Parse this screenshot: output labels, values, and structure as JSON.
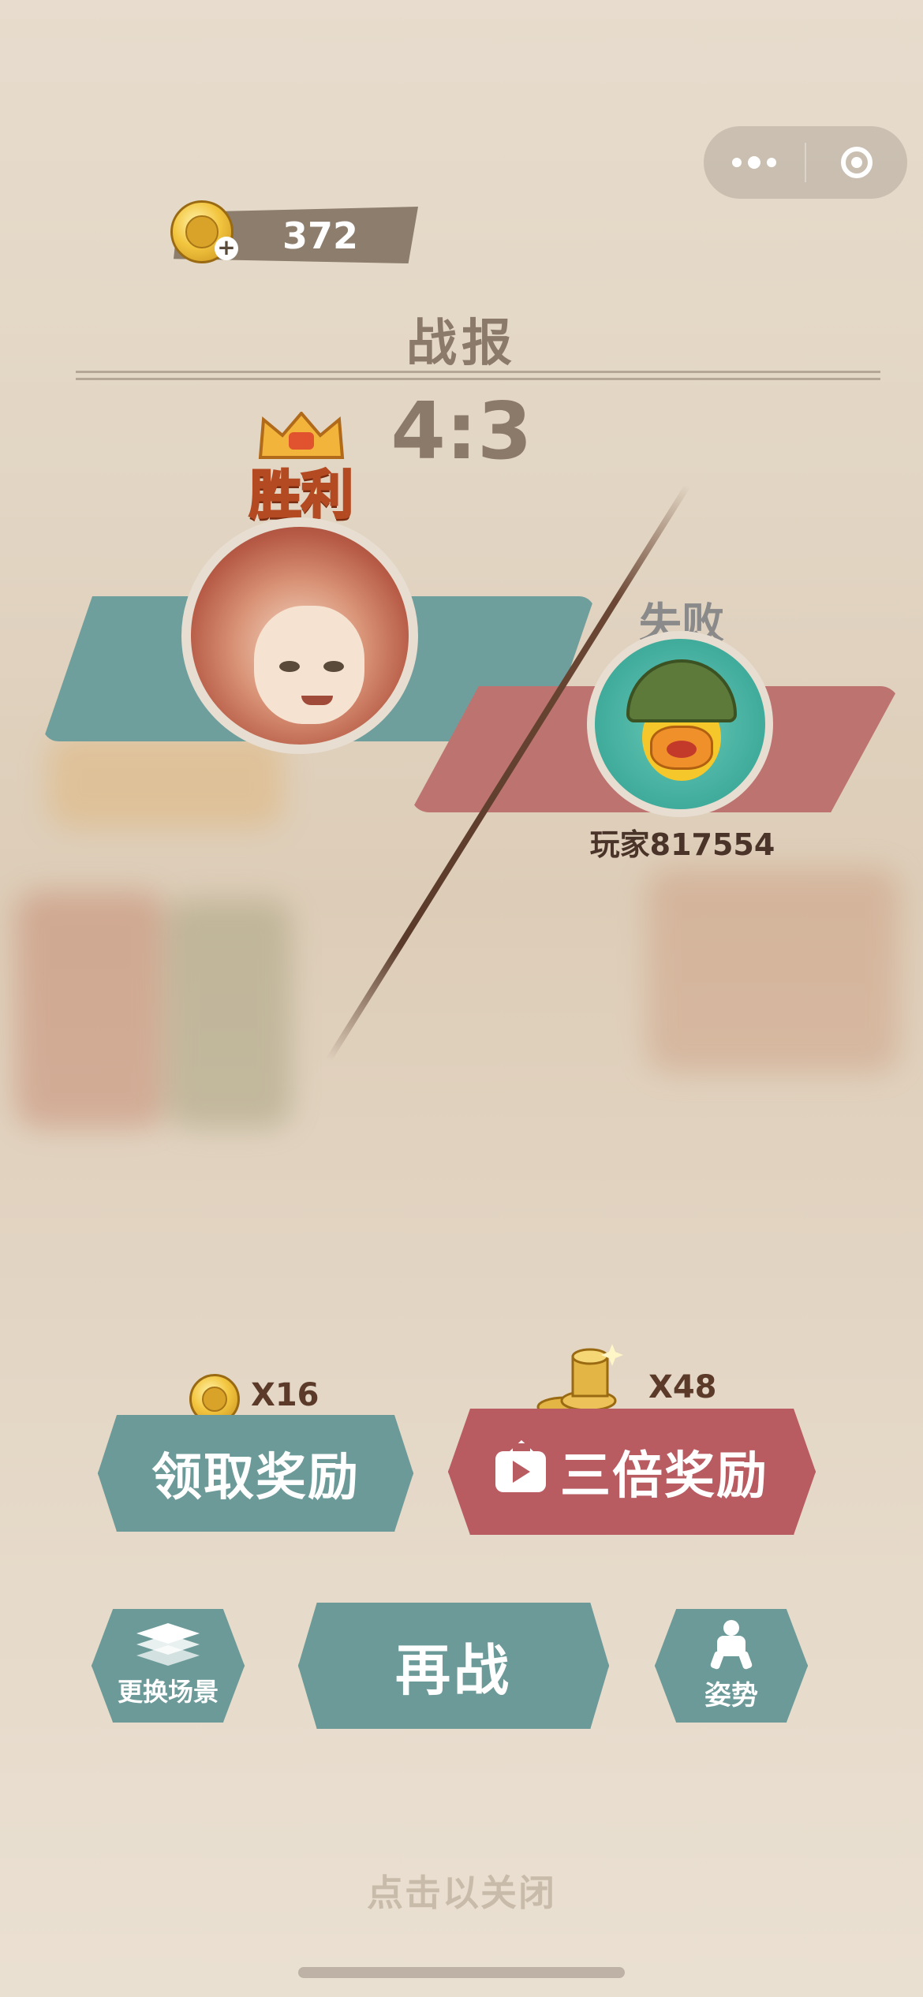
{
  "header": {
    "coins": "372",
    "title": "战报",
    "score": "4:3"
  },
  "players": {
    "winner_label": "胜利",
    "loser_label": "失败",
    "opponent_name": "玩家817554"
  },
  "rewards": {
    "claim_multiplier": "X16",
    "claim_label": "领取奖励",
    "triple_multiplier": "X48",
    "triple_label": "三倍奖励"
  },
  "actions": {
    "scene_label": "更换场景",
    "again_label": "再战",
    "pose_label": "姿势"
  },
  "footer": {
    "close_hint": "点击以关闭"
  },
  "colors": {
    "teal": "#6b9a98",
    "red": "#b85c62",
    "band_teal": "#6f9f9c",
    "band_red": "#bd7470"
  },
  "icons": [
    "more-dots-icon",
    "close-target-icon",
    "coin-icon",
    "plus-icon",
    "crown-icon",
    "coin-stack-icon",
    "tv-play-icon",
    "layers-icon",
    "pose-icon"
  ]
}
